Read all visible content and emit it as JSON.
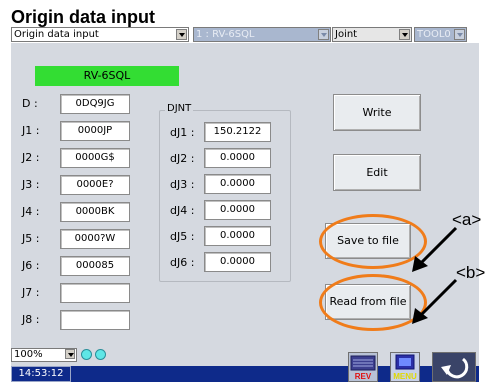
{
  "page_title": "Origin data input",
  "topbar": {
    "screen_select": "Origin data input",
    "robot_select": "1 : RV-6SQL",
    "jog_mode_select": "Joint",
    "tool_select": "TOOL0"
  },
  "robot_name": "RV-6SQL",
  "origin_fields": [
    {
      "label": "D :",
      "value": "0DQ9JG"
    },
    {
      "label": "J1 :",
      "value": "0000JP"
    },
    {
      "label": "J2 :",
      "value": "0000G$"
    },
    {
      "label": "J3 :",
      "value": "0000E?"
    },
    {
      "label": "J4 :",
      "value": "0000BK"
    },
    {
      "label": "J5 :",
      "value": "0000?W"
    },
    {
      "label": "J6 :",
      "value": "000085"
    },
    {
      "label": "J7 :",
      "value": ""
    },
    {
      "label": "J8 :",
      "value": ""
    }
  ],
  "joint_group": {
    "title": "DJNT",
    "rows": [
      {
        "label": "dJ1 :",
        "value": "150.2122"
      },
      {
        "label": "dJ2 :",
        "value": "0.0000"
      },
      {
        "label": "dJ3 :",
        "value": "0.0000"
      },
      {
        "label": "dJ4 :",
        "value": "0.0000"
      },
      {
        "label": "dJ5 :",
        "value": "0.0000"
      },
      {
        "label": "dJ6 :",
        "value": "0.0000"
      }
    ]
  },
  "buttons": {
    "write": "Write",
    "edit": "Edit",
    "save_to_file": "Save to file",
    "read_from_file": "Read from file"
  },
  "callouts": {
    "a": "<a>",
    "b": "<b>"
  },
  "zoom_level": "100%",
  "status_time": "14:53:12",
  "bottom_icons": {
    "rev_label": "REV",
    "menu_label": "MENU"
  },
  "colors": {
    "robot_banner": "#33dd33",
    "panel": "#d5d9e0",
    "status_bar": "#0e2a8a",
    "highlight_circle": "#f07c1a",
    "status_dot": "#5fe6e6"
  }
}
